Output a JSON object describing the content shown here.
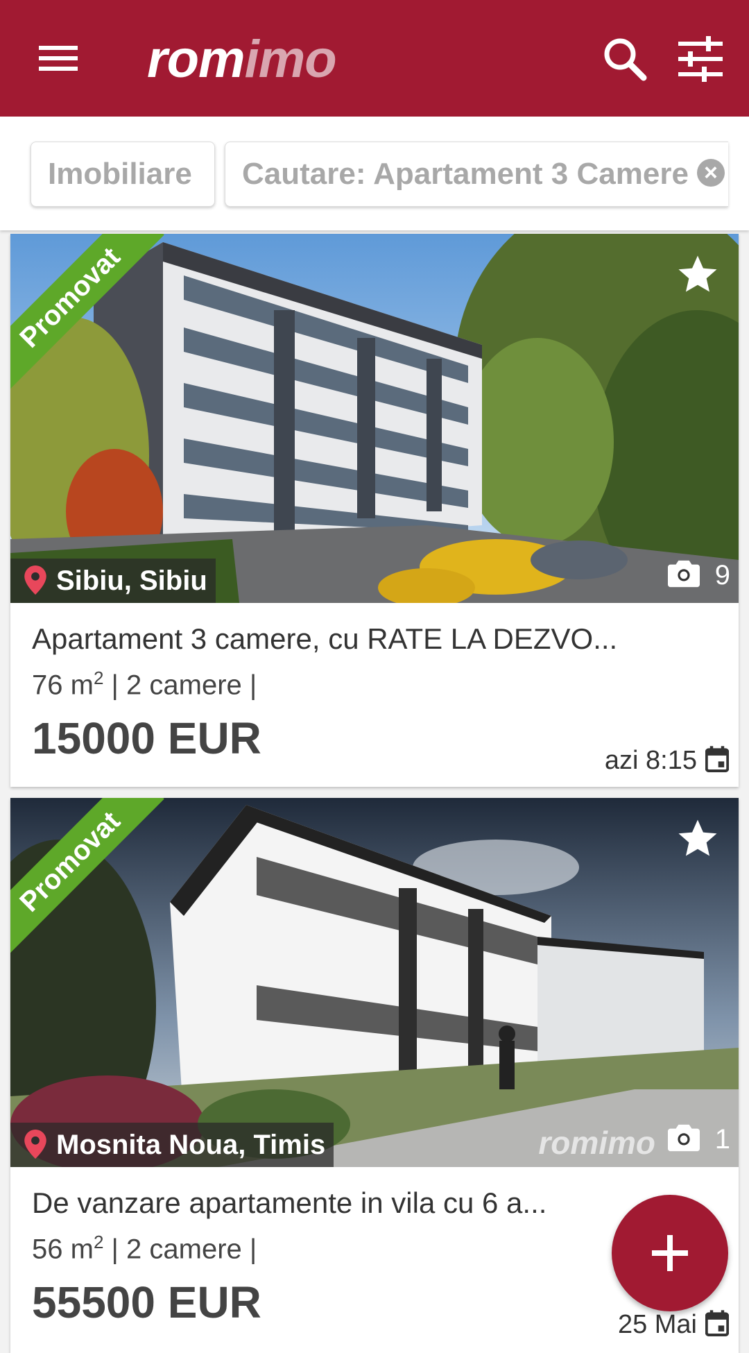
{
  "app": {
    "logo_part1": "rom",
    "logo_part2": "imo",
    "menu_icon": "hamburger-menu-icon",
    "search_icon": "search-icon",
    "filter_icon": "tune-sliders-icon",
    "brand_color": "#a11a32"
  },
  "filters": {
    "chips": [
      {
        "label": "Imobiliare"
      },
      {
        "label": "Cautare: Apartament 3 Camere",
        "close_icon": "close-circle-icon"
      }
    ]
  },
  "listings": [
    {
      "badge": "Promovat",
      "location": "Sibiu, Sibiu",
      "photo_count": "9",
      "title": "Apartament 3 camere, cu RATE LA DEZVO...",
      "area": "76 m",
      "area_sup": "2",
      "rooms": " | 2 camere |",
      "price": "15000 EUR",
      "date": "azi 8:15"
    },
    {
      "badge": "Promovat",
      "location": "Mosnita Noua, Timis",
      "photo_count": "1",
      "watermark": "romimo",
      "title": "De vanzare apartamente in vila cu 6 a...",
      "area": "56 m",
      "area_sup": "2",
      "rooms": " | 2 camere |",
      "price": "55500 EUR",
      "date": "25 Mai"
    }
  ],
  "fab": {
    "icon": "plus-icon"
  }
}
